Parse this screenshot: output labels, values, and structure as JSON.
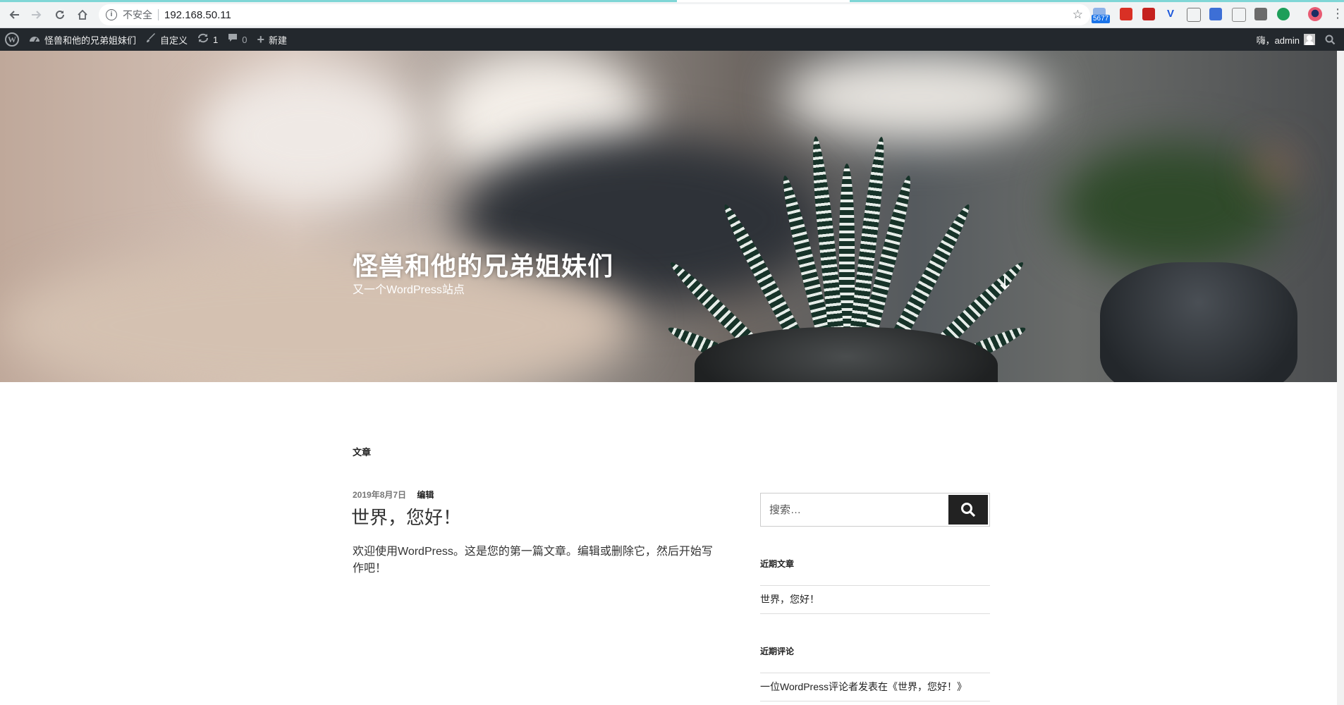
{
  "browser": {
    "insecure_label": "不安全",
    "address": "192.168.50.11",
    "extension_badge": "5677"
  },
  "adminbar": {
    "site_name": "怪兽和他的兄弟姐妹们",
    "customize": "自定义",
    "updates_count": "1",
    "comments_count": "0",
    "new_label": "新建",
    "greeting": "嗨，admin"
  },
  "header": {
    "site_title": "怪兽和他的兄弟姐妹们",
    "tagline": "又一个WordPress站点"
  },
  "main": {
    "page_label": "文章",
    "post": {
      "date": "2019年8月7日",
      "edit_label": "编辑",
      "title": "世界，您好！",
      "excerpt": "欢迎使用WordPress。这是您的第一篇文章。编辑或删除它，然后开始写作吧！"
    }
  },
  "sidebar": {
    "search_placeholder": "搜索…",
    "recent_posts_title": "近期文章",
    "recent_posts": [
      "世界，您好！"
    ],
    "recent_comments_title": "近期评论",
    "recent_comments": [
      "一位WordPress评论者发表在《世界，您好！》"
    ]
  }
}
